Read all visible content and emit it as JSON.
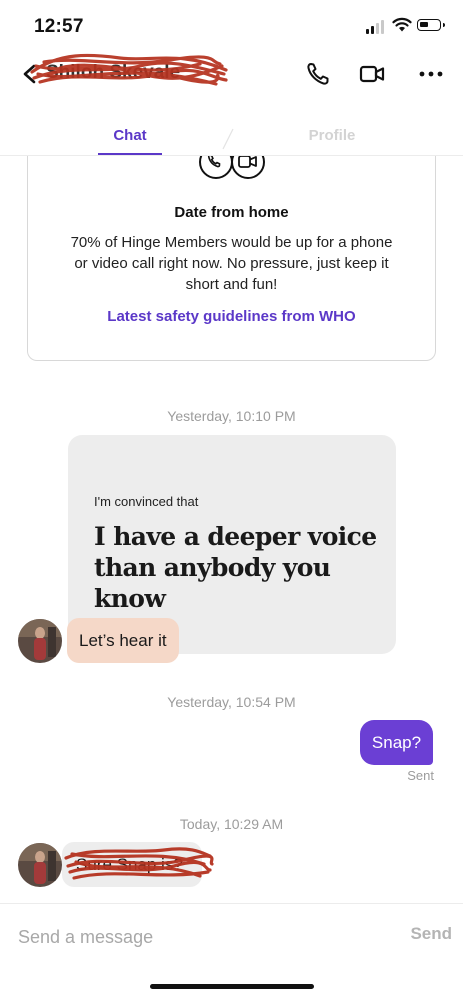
{
  "status_bar": {
    "time": "12:57"
  },
  "header": {
    "contact_name": "Shiloh Skevale"
  },
  "tabs": [
    {
      "label": "Chat",
      "active": true
    },
    {
      "label": "Profile",
      "active": false
    }
  ],
  "info_card": {
    "title": "Date from home",
    "body": "70% of Hinge Members would be up for a phone or video call right now. No pressure, just keep it short and fun!",
    "link": "Latest safety guidelines from WHO"
  },
  "messages": {
    "timestamp_1": "Yesterday, 10:10 PM",
    "prompt_label": "I'm convinced that",
    "prompt_answer": "I have a deeper voice than anybody you know",
    "reply_1": "Let’s hear it",
    "timestamp_2": "Yesterday, 10:54 PM",
    "outgoing_1": "Snap?",
    "outgoing_1_status": "Sent",
    "timestamp_3": "Today, 10:29 AM",
    "incoming_2": "Sure Snap is?"
  },
  "composer": {
    "placeholder": "Send a message",
    "send_label": "Send"
  },
  "colors": {
    "accent": "#5b38c8",
    "outgoing_bubble": "#6b3fd4",
    "incoming_reply_bubble": "#f5d8c8",
    "prompt_card": "#ededed",
    "redaction": "#b5321f"
  }
}
